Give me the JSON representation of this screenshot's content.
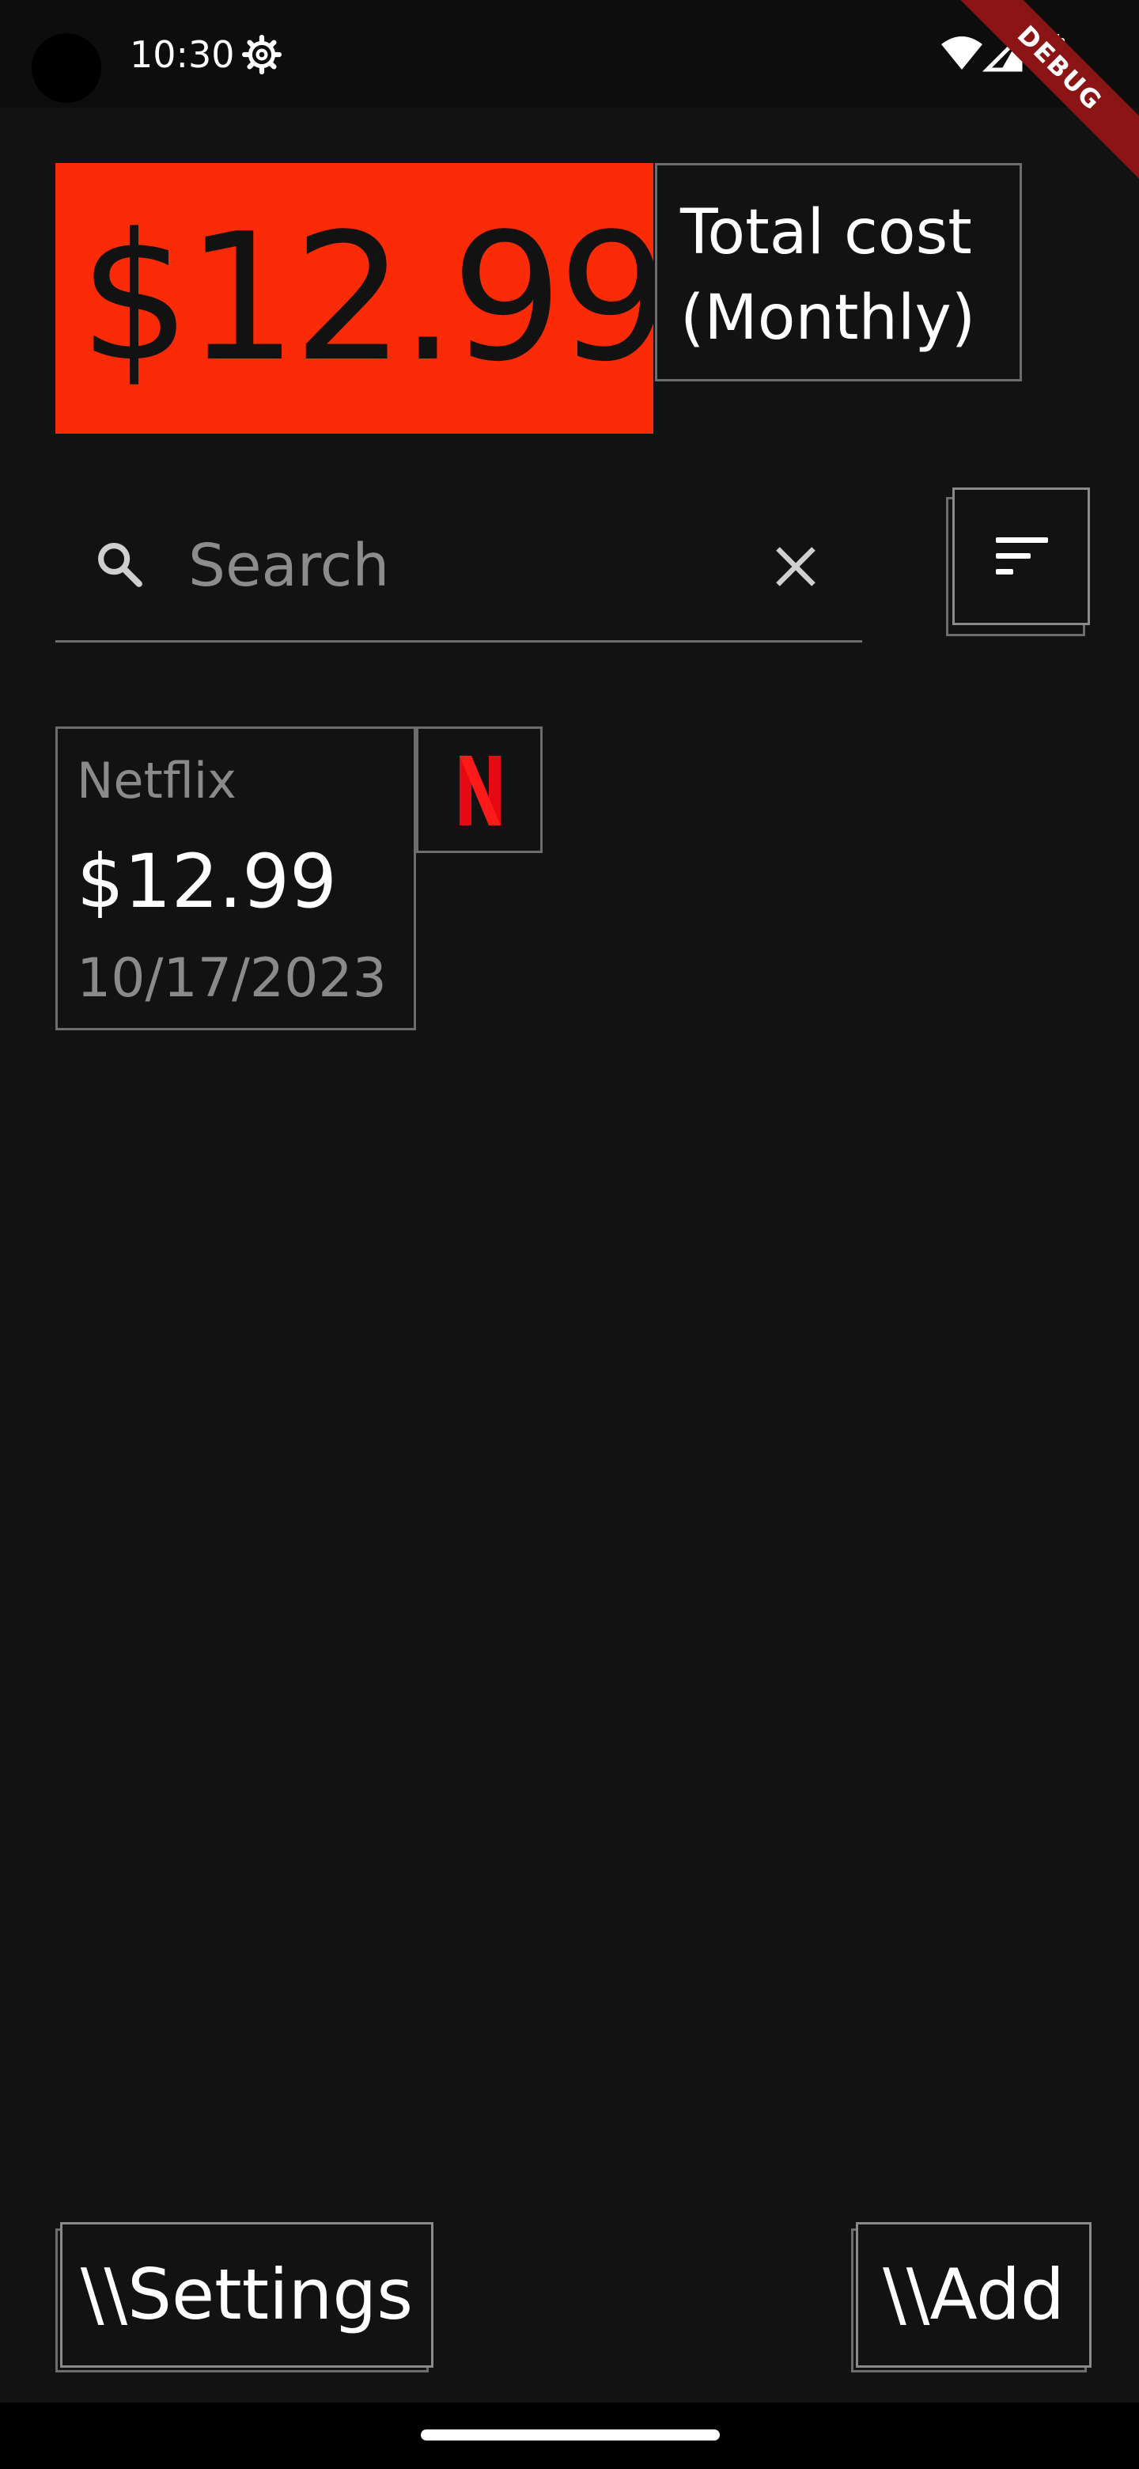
{
  "status_bar": {
    "time": "10:30",
    "icons": [
      "settings-gear-icon",
      "wifi-icon",
      "cell-signal-icon",
      "battery-icon"
    ],
    "debug_banner": "DEBUG"
  },
  "summary": {
    "total_amount": "$12.99",
    "total_label": "Total cost\n(Monthly)",
    "accent_color": "#fb2a07"
  },
  "search": {
    "placeholder": "Search",
    "value": ""
  },
  "subscriptions": [
    {
      "name": "Netflix",
      "price": "$12.99",
      "date": "10/17/2023",
      "logo": "netflix-n-icon",
      "logo_color": "#e50914"
    }
  ],
  "footer": {
    "settings_label": "\\\\Settings",
    "add_label": "\\\\Add"
  }
}
